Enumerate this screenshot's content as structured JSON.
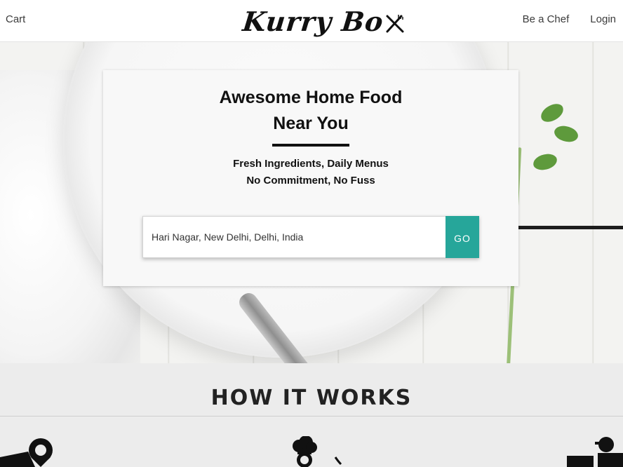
{
  "header": {
    "cart_label": "Cart",
    "logo_text": "Kurry Bo",
    "logo_icon": "fork-knife-cross-icon",
    "be_chef_label": "Be a Chef",
    "login_label": "Login"
  },
  "hero": {
    "title_line1": "Awesome Home Food",
    "title_line2": "Near You",
    "subtitle_line1": "Fresh Ingredients, Daily Menus",
    "subtitle_line2": "No Commitment, No Fuss",
    "search": {
      "value": "Hari Nagar, New Delhi, Delhi, India",
      "button_label": "GO"
    }
  },
  "how_it_works": {
    "title": "HOW IT WORKS",
    "icons": [
      "location-pin-icon",
      "chef-hat-icon",
      "delivery-icon"
    ]
  },
  "colors": {
    "accent": "#26a69a",
    "text": "#111111",
    "nav_text": "#3b3b3b"
  }
}
